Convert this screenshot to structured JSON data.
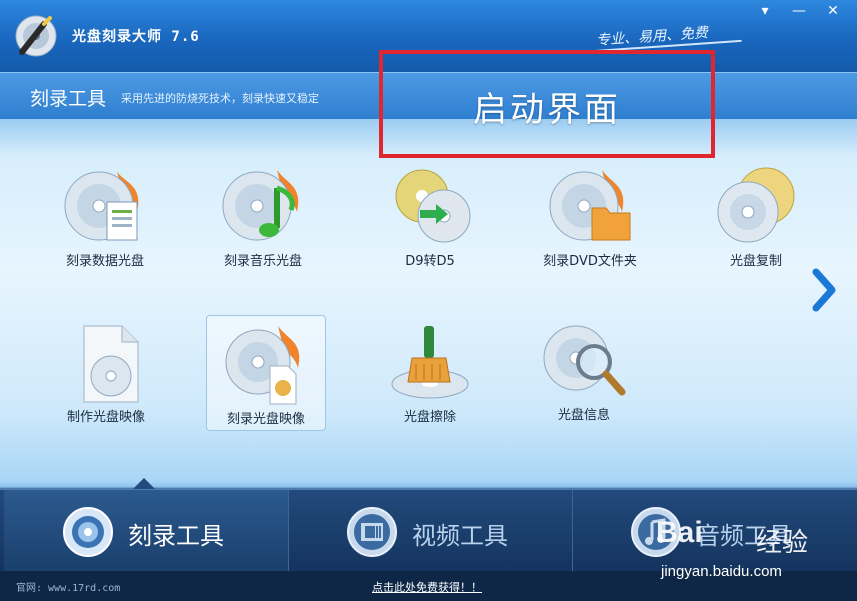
{
  "window": {
    "title": "光盘刻录大师 7.6",
    "slogan": "专业、易用、免费",
    "buttons": {
      "menu": "▾",
      "minimize": "—",
      "close": "✕"
    }
  },
  "header": {
    "section_title": "刻录工具",
    "section_desc": "采用先进的防烧死技术，刻录快速又稳定"
  },
  "annotation": {
    "text": "启动界面",
    "color": "#e0262e"
  },
  "tools": [
    {
      "label": "刻录数据光盘",
      "icon": "data-disc-icon"
    },
    {
      "label": "刻录音乐光盘",
      "icon": "music-disc-icon"
    },
    {
      "label": "D9转D5",
      "icon": "dvd-convert-icon"
    },
    {
      "label": "刻录DVD文件夹",
      "icon": "dvd-folder-icon"
    },
    {
      "label": "光盘复制",
      "icon": "disc-copy-icon"
    },
    {
      "label": "制作光盘映像",
      "icon": "make-image-icon"
    },
    {
      "label": "刻录光盘映像",
      "icon": "burn-image-icon",
      "selected": true
    },
    {
      "label": "光盘擦除",
      "icon": "disc-erase-icon"
    },
    {
      "label": "光盘信息",
      "icon": "disc-info-icon"
    }
  ],
  "bottom_tabs": [
    {
      "label": "刻录工具",
      "icon": "disc-icon",
      "active": true
    },
    {
      "label": "视频工具",
      "icon": "film-icon",
      "active": false
    },
    {
      "label": "音频工具",
      "icon": "music-note-icon",
      "active": false
    }
  ],
  "footer": {
    "website": "官网: www.17rd.com",
    "promo": "点击此处免费获得！！"
  },
  "watermark": {
    "brand": "Bai",
    "brand_tail": "经验",
    "url": "jingyan.baidu.com"
  }
}
